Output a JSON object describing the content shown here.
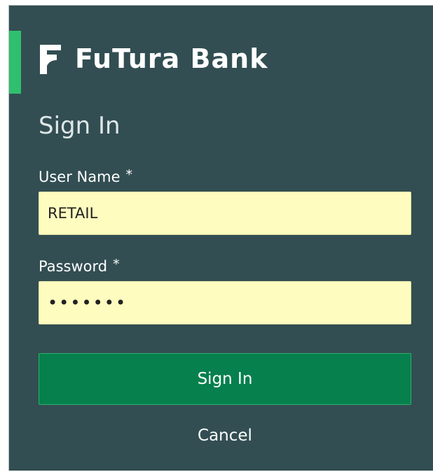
{
  "brand": {
    "name": "FuTura Bank",
    "logo_icon": "futura-f-logo-icon",
    "logo_color": "#ffffff"
  },
  "colors": {
    "panel_background": "#324e52",
    "accent_bar": "#2fbf6e",
    "input_background": "#fefcbf",
    "primary_button": "#06804d"
  },
  "form": {
    "title": "Sign In",
    "username": {
      "label": "User Name",
      "required_marker": "*",
      "value": "RETAIL"
    },
    "password": {
      "label": "Password",
      "required_marker": "*",
      "value": "•••••••"
    },
    "submit_label": "Sign In",
    "cancel_label": "Cancel"
  }
}
